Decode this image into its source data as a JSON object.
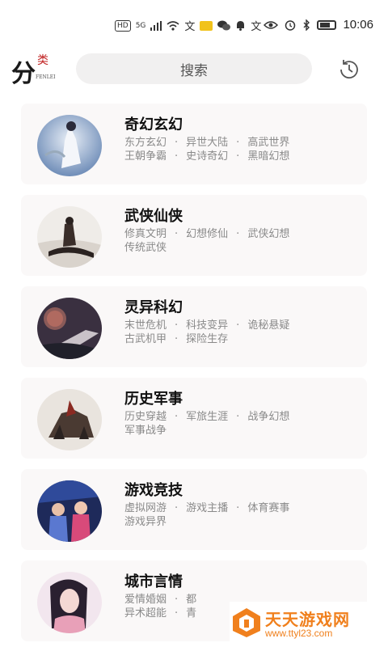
{
  "status_bar": {
    "hd_chip": "HD",
    "signal": "5G",
    "text_icon_1": "文",
    "text_icon_2": "文",
    "time": "10:06"
  },
  "header": {
    "logo_char": "分",
    "logo_red": "类",
    "logo_small": "FENLEI",
    "search_label": "搜索"
  },
  "categories": [
    {
      "title": "奇幻玄幻",
      "line1": [
        "东方玄幻",
        "异世大陆",
        "高武世界"
      ],
      "line2": [
        "王朝争霸",
        "史诗奇幻",
        "黑暗幻想"
      ]
    },
    {
      "title": "武侠仙侠",
      "line1": [
        "修真文明",
        "幻想修仙",
        "武侠幻想"
      ],
      "line2": [
        "传统武侠"
      ]
    },
    {
      "title": "灵异科幻",
      "line1": [
        "末世危机",
        "科技变异",
        "诡秘悬疑"
      ],
      "line2": [
        "古武机甲",
        "探险生存"
      ]
    },
    {
      "title": "历史军事",
      "line1": [
        "历史穿越",
        "军旅生涯",
        "战争幻想"
      ],
      "line2": [
        "军事战争"
      ]
    },
    {
      "title": "游戏竞技",
      "line1": [
        "虚拟网游",
        "游戏主播",
        "体育赛事"
      ],
      "line2": [
        "游戏异界"
      ]
    },
    {
      "title": "城市言情",
      "line1": [
        "爱情婚姻",
        "都"
      ],
      "line2": [
        "异术超能",
        "青"
      ]
    }
  ],
  "watermark": {
    "name": "天天游戏网",
    "url": "www.ttyl23.com"
  },
  "colors": {
    "card_bg": "#faf8f8",
    "search_bg": "#f1f0f0",
    "tag_text": "#8a8a8a",
    "watermark": "#f0801d",
    "logo_red": "#c02020"
  }
}
